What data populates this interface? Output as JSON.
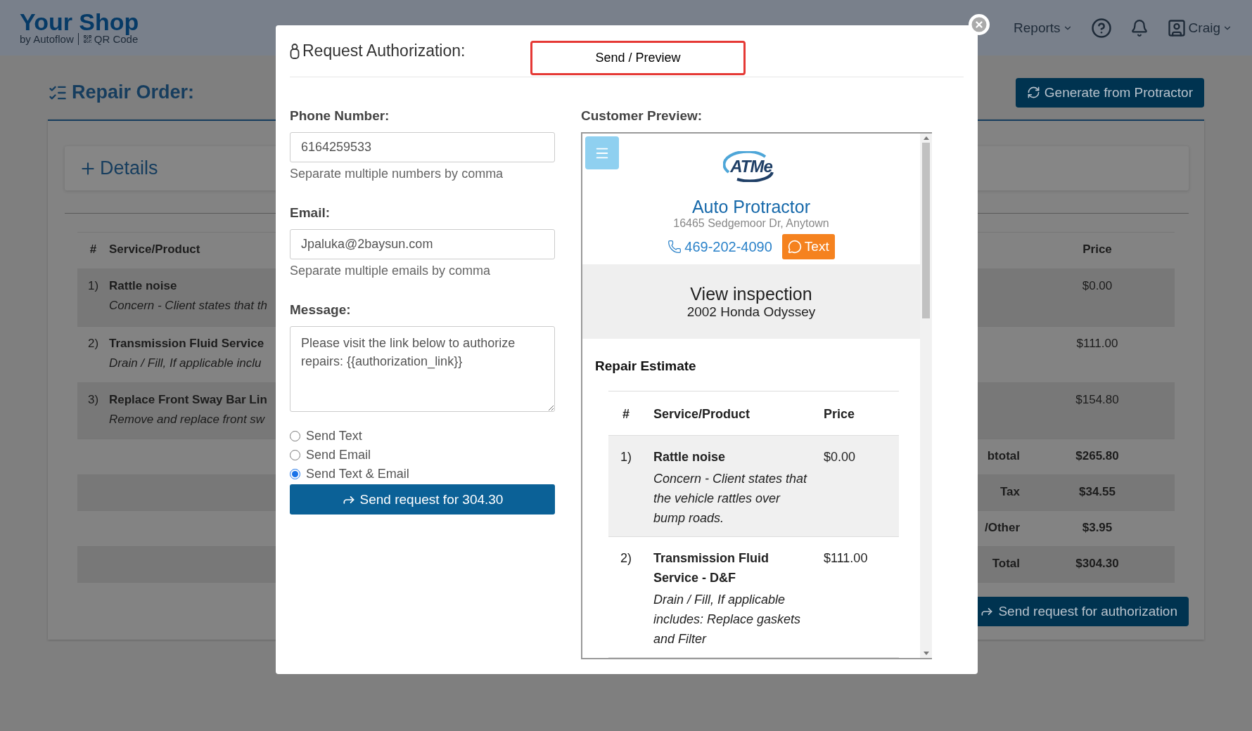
{
  "navbar": {
    "brand": "Your Shop",
    "subtitle": "by Autoflow",
    "qr_link": "QR Code",
    "menus": [
      {
        "label": "Reports"
      }
    ],
    "user": "Craig"
  },
  "page": {
    "title": "Repair Order:",
    "generate_button": "Generate from Protractor",
    "details": "Details",
    "table": {
      "columns": [
        "#",
        "Service/Product",
        "Price"
      ],
      "rows": [
        {
          "num": "1)",
          "name": "Rattle noise",
          "description": "Concern - Client states that th",
          "price": "$0.00"
        },
        {
          "num": "2)",
          "name": "Transmission Fluid Service",
          "description": "Drain / Fill, If applicable inclu",
          "price": "$111.00"
        },
        {
          "num": "3)",
          "name": "Replace Front Sway Bar Lin",
          "description": "Remove and replace front sw",
          "price": "$154.80"
        }
      ],
      "totals": [
        {
          "label": "btotal",
          "value": "$265.80"
        },
        {
          "label": "Tax",
          "value": "$34.55"
        },
        {
          "label": "/Other",
          "value": "$3.95"
        },
        {
          "label": "Total",
          "value": "$304.30"
        }
      ]
    },
    "send_button": "Send request for authorization"
  },
  "modal": {
    "title": "Request Authorization:",
    "preview_button": "Send / Preview",
    "fields": [
      {
        "label": "Phone Number:",
        "value": "6164259533",
        "help": "Separate multiple numbers by comma"
      },
      {
        "label": "Email:",
        "value": "Jpaluka@2baysun.com",
        "help": "Separate multiple emails by comma"
      }
    ],
    "message": {
      "label": "Message:",
      "value": "Please visit the link below to authorize repairs: {{authorization_link}}"
    },
    "options": [
      {
        "label": "Send Text",
        "selected": false
      },
      {
        "label": "Send Email",
        "selected": false
      },
      {
        "label": "Send Text & Email",
        "selected": true
      }
    ],
    "submit_button": "Send request for 304.30",
    "preview": {
      "label": "Customer Preview:",
      "logo": "ATMe",
      "shop_name": "Auto Protractor",
      "address": "16465 Sedgemoor Dr, Anytown",
      "phone": "469-202-4090",
      "text_button": "Text",
      "inspection_title": "View inspection",
      "vehicle": "2002 Honda Odyssey",
      "section": "Repair Estimate",
      "columns": [
        "#",
        "Service/Product",
        "Price"
      ],
      "rows": [
        {
          "num": "1)",
          "name": "Rattle noise",
          "description": "Concern - Client states that the vehicle rattles over bump roads.",
          "price": "$0.00"
        },
        {
          "num": "2)",
          "name": "Transmission Fluid Service - D&F",
          "description": "Drain / Fill, If applicable includes: Replace gaskets and Filter",
          "price": "$111.00"
        }
      ]
    }
  }
}
